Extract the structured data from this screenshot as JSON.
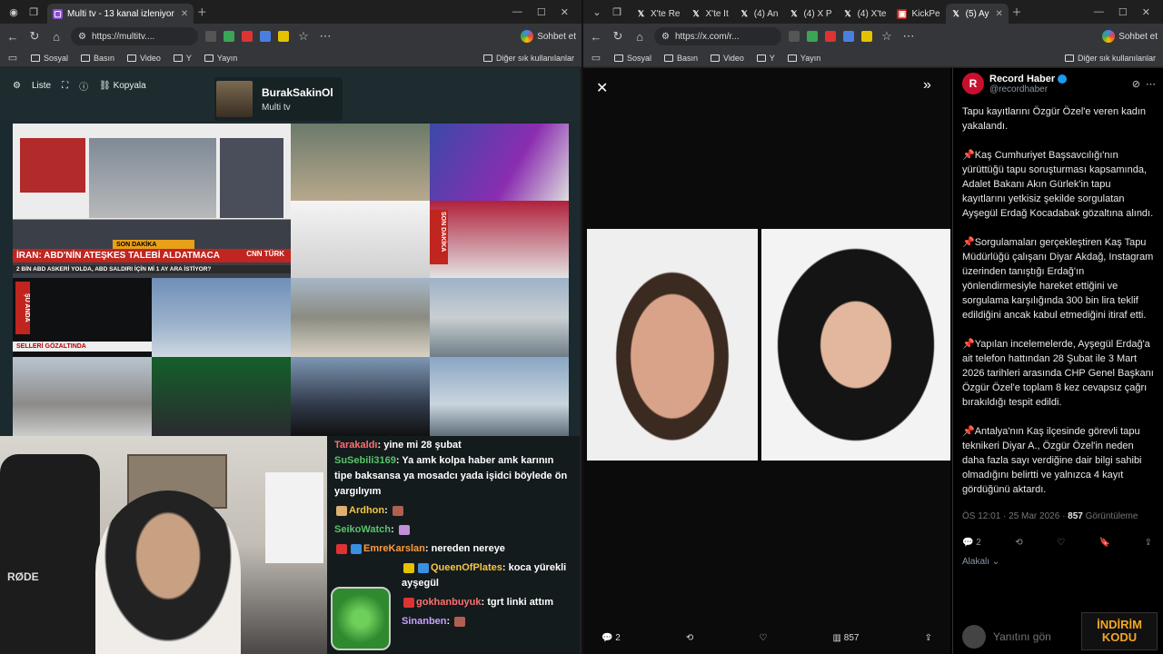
{
  "left_browser": {
    "tabs": [
      {
        "label": "Multi tv - 13 kanal izleniyor"
      }
    ],
    "url": "https://multitv....",
    "sohbet_label": "Sohbet et",
    "bookmarks": [
      "Sosyal",
      "Basın",
      "Video",
      "Y",
      "Yayın"
    ],
    "bookmarks_right": "Diğer sık kullanılanlar"
  },
  "multitv": {
    "controls": {
      "liste": "Liste",
      "kopyala": "Kopyala"
    },
    "user": {
      "name": "BurakSakinOl",
      "sub": "Multi tv"
    },
    "tiles": {
      "breaking": "SON DAKİKA",
      "headline": "İRAN: ABD'NİN ATEŞKES TALEBİ ALDATMACA",
      "ticker": "2 BİN ABD ASKERİ YOLDA, ABD SALDIRI İÇİN Mİ 1 AY ARA İSTİYOR?",
      "channel": "CNN TÜRK",
      "su_anda": "ŞU ANDA",
      "gozaltinda": "SELLERİ GÖZALTINDA",
      "son_dakika2": "SON DAKİKA"
    }
  },
  "chat": {
    "messages": [
      {
        "nick": "Tarakaldı",
        "color": "#ff6f6f",
        "text": "yine mi 28 şubat"
      },
      {
        "nick": "SuSebili3169",
        "color": "#58c46a",
        "text": "Ya amk kolpa haber amk karının tipe baksansa ya mosadcı yada işidci böylede ön yargılıyım"
      },
      {
        "nick": "Ardhon",
        "color": "#f4c542",
        "text": ""
      },
      {
        "nick": "SeikoWatch",
        "color": "#58c46a",
        "text": ""
      },
      {
        "nick": "EmreKarslan",
        "color": "#ff9a3c",
        "text": "nereden nereye"
      },
      {
        "nick": "QueenOfPlates",
        "color": "#f4c542",
        "text": "koca yürekli ayşegül"
      },
      {
        "nick": "gokhanbuyuk",
        "color": "#ff6f6f",
        "text": "tgrt linki attım"
      },
      {
        "nick": "Sinanben",
        "color": "#c8a0ff",
        "text": ""
      }
    ]
  },
  "right_browser": {
    "tabs": [
      {
        "label": "X'te Re"
      },
      {
        "label": "X'te It"
      },
      {
        "label": "(4) An"
      },
      {
        "label": "(4) X P"
      },
      {
        "label": "(4) X'te"
      },
      {
        "label": "KickPe"
      },
      {
        "label": "(5) Ay"
      }
    ],
    "url": "https://x.com/r...",
    "sohbet_label": "Sohbet et",
    "bookmarks": [
      "Sosyal",
      "Basın",
      "Video",
      "Y",
      "Yayın"
    ],
    "bookmarks_right": "Diğer sık kullanılanlar"
  },
  "post": {
    "author": "Record Haber",
    "handle": "@recordhaber",
    "paragraphs": [
      "Tapu kayıtlarını Özgür Özel'e veren kadın yakalandı.",
      "📌Kaş Cumhuriyet Başsavcılığı'nın yürüttüğü tapu soruşturması kapsamında, Adalet Bakanı Akın Gürlek'in tapu kayıtlarını yetkisiz şekilde sorgulatan Ayşegül Erdağ Kocadabak gözaltına alındı.",
      "📌Sorgulamaları gerçekleştiren Kaş Tapu Müdürlüğü çalışanı Diyar Akdağ, Instagram üzerinden tanıştığı Erdağ'ın yönlendirmesiyle hareket ettiğini ve sorgulama karşılığında 300 bin lira teklif edildiğini ancak kabul etmediğini itiraf etti.",
      "📌Yapılan incelemelerde, Ayşegül Erdağ'a ait telefon hattından 28 Şubat ile 3 Mart 2026 tarihleri arasında CHP Genel Başkanı Özgür Özel'e toplam 8 kez cevapsız çağrı bırakıldığı tespit edildi.",
      "📌Antalya'nın Kaş ilçesinde görevli tapu teknikeri Diyar A., Özgür Özel'in neden daha fazla sayı verdiğine dair bilgi sahibi olmadığını belirtti ve yalnızca 4 kayıt gördüğünü aktardı."
    ],
    "timestamp": "ÖS 12:01 · 25 Mar 2026 · ",
    "views": "857",
    "views_label": " Görüntüleme",
    "replies": "2",
    "media_replies": "2",
    "media_views": "857",
    "alakali": "Alakalı",
    "reply_placeholder": "Yanıtını gön",
    "promo": "İNDİRİM KODU"
  }
}
